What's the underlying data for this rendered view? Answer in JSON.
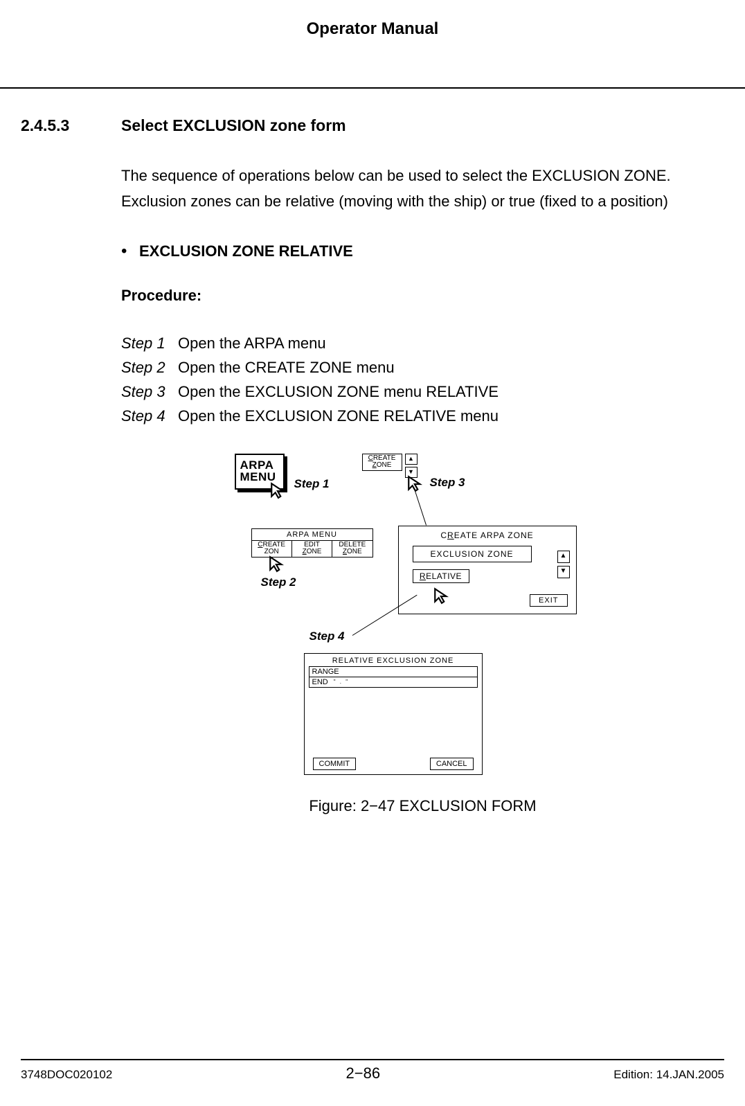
{
  "header": {
    "title": "Operator Manual"
  },
  "section": {
    "number": "2.4.5.3",
    "title": "Select EXCLUSION zone form"
  },
  "para1": "The sequence of operations below can be used to select the EXCLUSION ZONE. Exclusion zones can be relative (moving with the ship) or true (fixed to a position)",
  "bullet1": "EXCLUSION ZONE RELATIVE",
  "procedure_label": "Procedure:",
  "steps": [
    {
      "label": "Step 1",
      "text": "Open the ARPA menu"
    },
    {
      "label": "Step 2",
      "text": "Open the CREATE ZONE menu"
    },
    {
      "label": "Step 3",
      "text": "Open the EXCLUSION ZONE menu RELATIVE"
    },
    {
      "label": "Step 4",
      "text": "Open the EXCLUSION ZONE RELATIVE menu"
    }
  ],
  "figure": {
    "step_labels": {
      "s1": "Step 1",
      "s2": "Step 2",
      "s3": "Step 3",
      "s4": "Step 4"
    },
    "arpa_menu_btn": "ARPA\nMENU",
    "arpa_menu_bar": {
      "title": "ARPA  MENU",
      "cells": [
        "CREATE ZON",
        "EDIT ZONE",
        "DELETE ZONE"
      ]
    },
    "create_zone_small": "CREATE ZONE",
    "create_arpa_zone": {
      "title": "CREATE ARPA ZONE",
      "field": "EXCLUSION ZONE",
      "relative": "RELATIVE",
      "exit": "EXIT"
    },
    "rel_excl_zone": {
      "title": "RELATIVE  EXCLUSION  ZONE",
      "row1": "RANGE",
      "row2": "END",
      "row2_val": "\" . \"",
      "commit": "COMMIT",
      "cancel": "CANCEL"
    },
    "caption": "Figure: 2−47 EXCLUSION FORM"
  },
  "footer": {
    "left": "3748DOC020102",
    "center": "2−86",
    "right": "Edition: 14.JAN.2005"
  }
}
